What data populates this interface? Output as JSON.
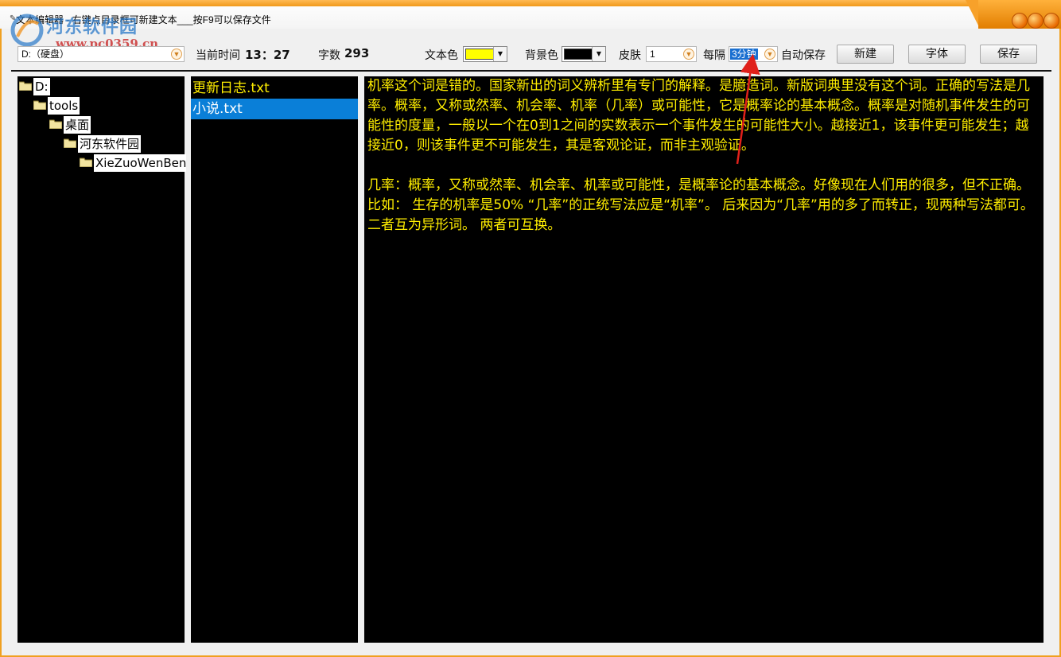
{
  "window": {
    "title": "文本编辑器 - 右键点目录框可新建文本___按F9可以保存文件",
    "colors": {
      "frame": "#f0a020",
      "editor_bg": "#000000",
      "text": "#ffee00",
      "selection": "#0a7fd8"
    }
  },
  "watermark": {
    "site": "河东软件园",
    "url": "www.pc0359.cn"
  },
  "toolbar": {
    "drive_select": "D:（硬盘）",
    "time_label": "当前时间",
    "time_value": "13：27",
    "count_label": "字数",
    "count_value": "293",
    "text_color_label": "文本色",
    "text_color": "#ffff00",
    "bg_color_label": "背景色",
    "bg_color": "#000000",
    "skin_label": "皮肤",
    "skin_value": "1",
    "interval_label": "每隔",
    "interval_value": "3分钟",
    "autosave_label": "自动保存",
    "new_button": "新建",
    "font_button": "字体",
    "save_button": "保存"
  },
  "tree": {
    "items": [
      {
        "label": "D:",
        "icon": "folder-open-icon"
      },
      {
        "label": "tools",
        "icon": "folder-open-icon"
      },
      {
        "label": "桌面",
        "icon": "folder-open-icon"
      },
      {
        "label": "河东软件园",
        "icon": "folder-open-icon"
      },
      {
        "label": "XieZuoWenBen",
        "icon": "folder-open-icon"
      }
    ]
  },
  "files": {
    "items": [
      {
        "label": "更新日志.txt",
        "selected": false
      },
      {
        "label": "小说.txt",
        "selected": true
      }
    ]
  },
  "editor": {
    "paragraphs": [
      "机率这个词是错的。国家新出的词义辨析里有专门的解释。是臆造词。新版词典里没有这个词。正确的写法是几率。概率，又称或然率、机会率、机率（几率）或可能性，它是概率论的基本概念。概率是对随机事件发生的可能性的度量，一般以一个在0到1之间的实数表示一个事件发生的可能性大小。越接近1，该事件更可能发生；越接近0，则该事件更不可能发生，其是客观论证，而非主观验证。",
      "几率：概率，又称或然率、机会率、机率或可能性，是概率论的基本概念。好像现在人们用的很多，但不正确。 比如： 生存的机率是50% “几率”的正统写法应是“机率”。 后来因为“几率”用的多了而转正，现两种写法都可。 二者互为异形词。 两者可互换。"
    ]
  }
}
